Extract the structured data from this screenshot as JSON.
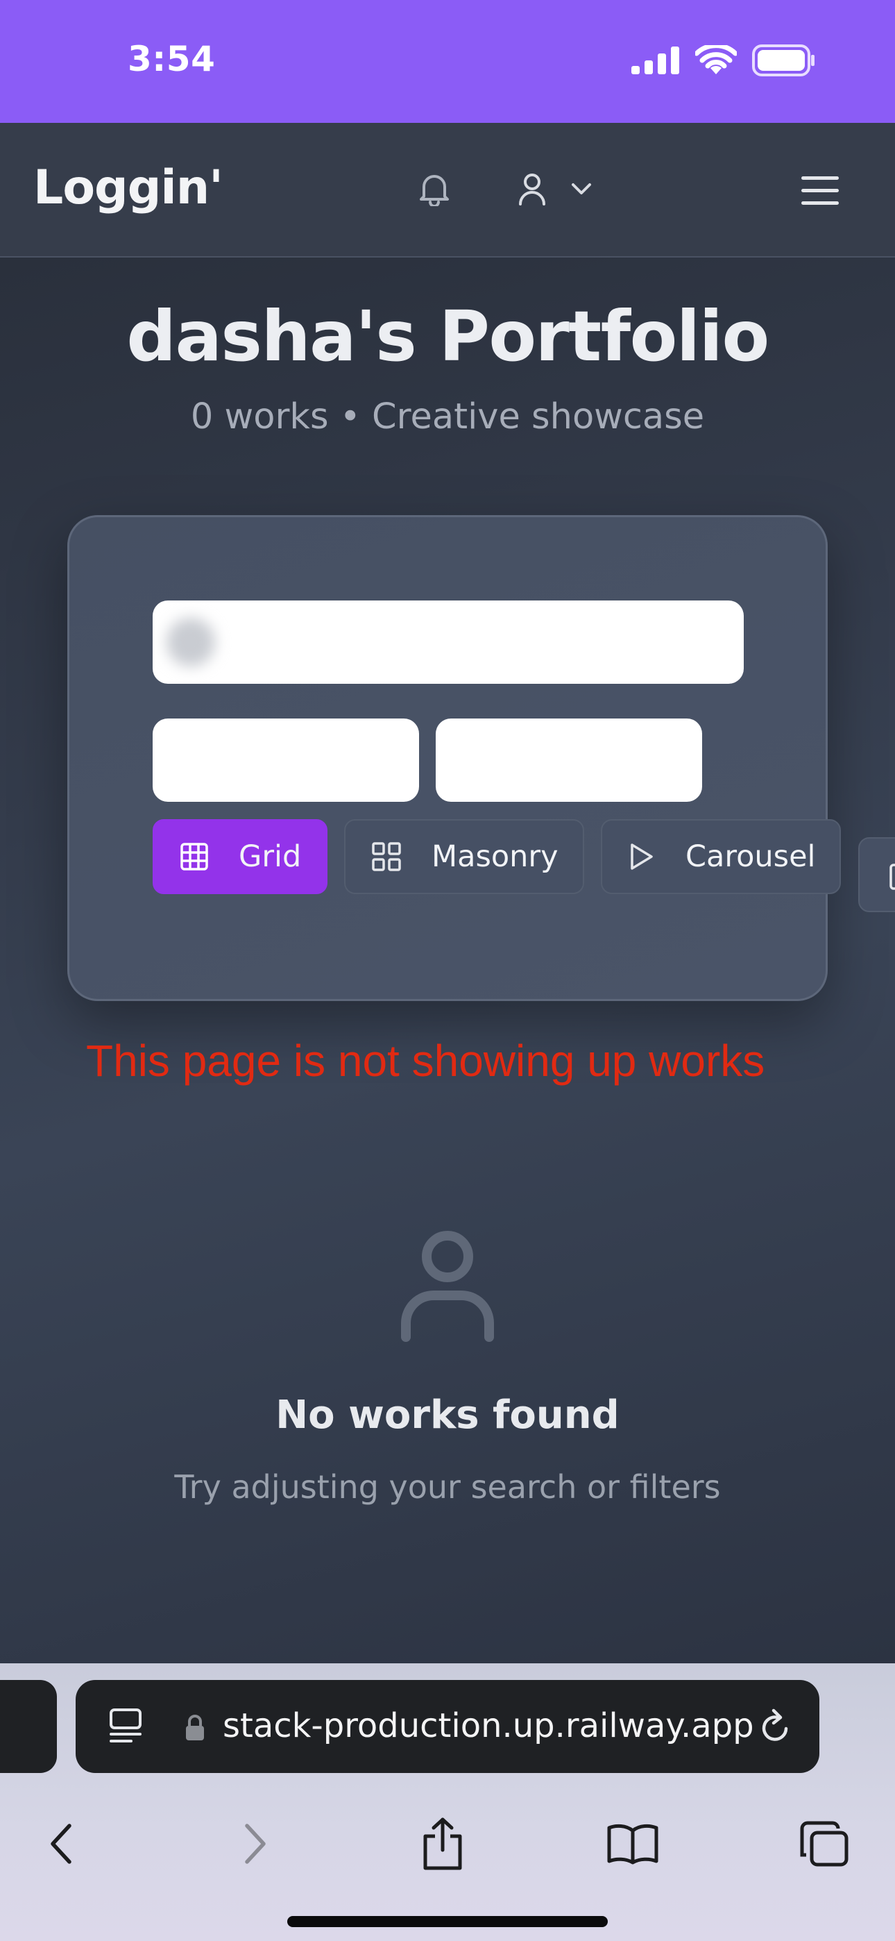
{
  "status_bar": {
    "time": "3:54"
  },
  "header": {
    "brand": "Loggin'"
  },
  "portfolio": {
    "title": "dasha's Portfolio",
    "subtitle": "0 works • Creative showcase"
  },
  "filters": {
    "search_value": "",
    "view_modes": [
      {
        "label": "Grid",
        "icon": "grid-icon",
        "active": true
      },
      {
        "label": "Masonry",
        "icon": "masonry-icon",
        "active": false
      },
      {
        "label": "Carousel",
        "icon": "play-icon",
        "active": false
      }
    ]
  },
  "annotation": {
    "text": "This page is not showing up works",
    "color": "#e12a12"
  },
  "empty_state": {
    "title": "No works found",
    "subtitle": "Try adjusting your search or filters"
  },
  "browser": {
    "url": "stack-production.up.railway.app"
  },
  "colors": {
    "status_bar": "#8b5cf6",
    "active_view": "#9333ea"
  }
}
